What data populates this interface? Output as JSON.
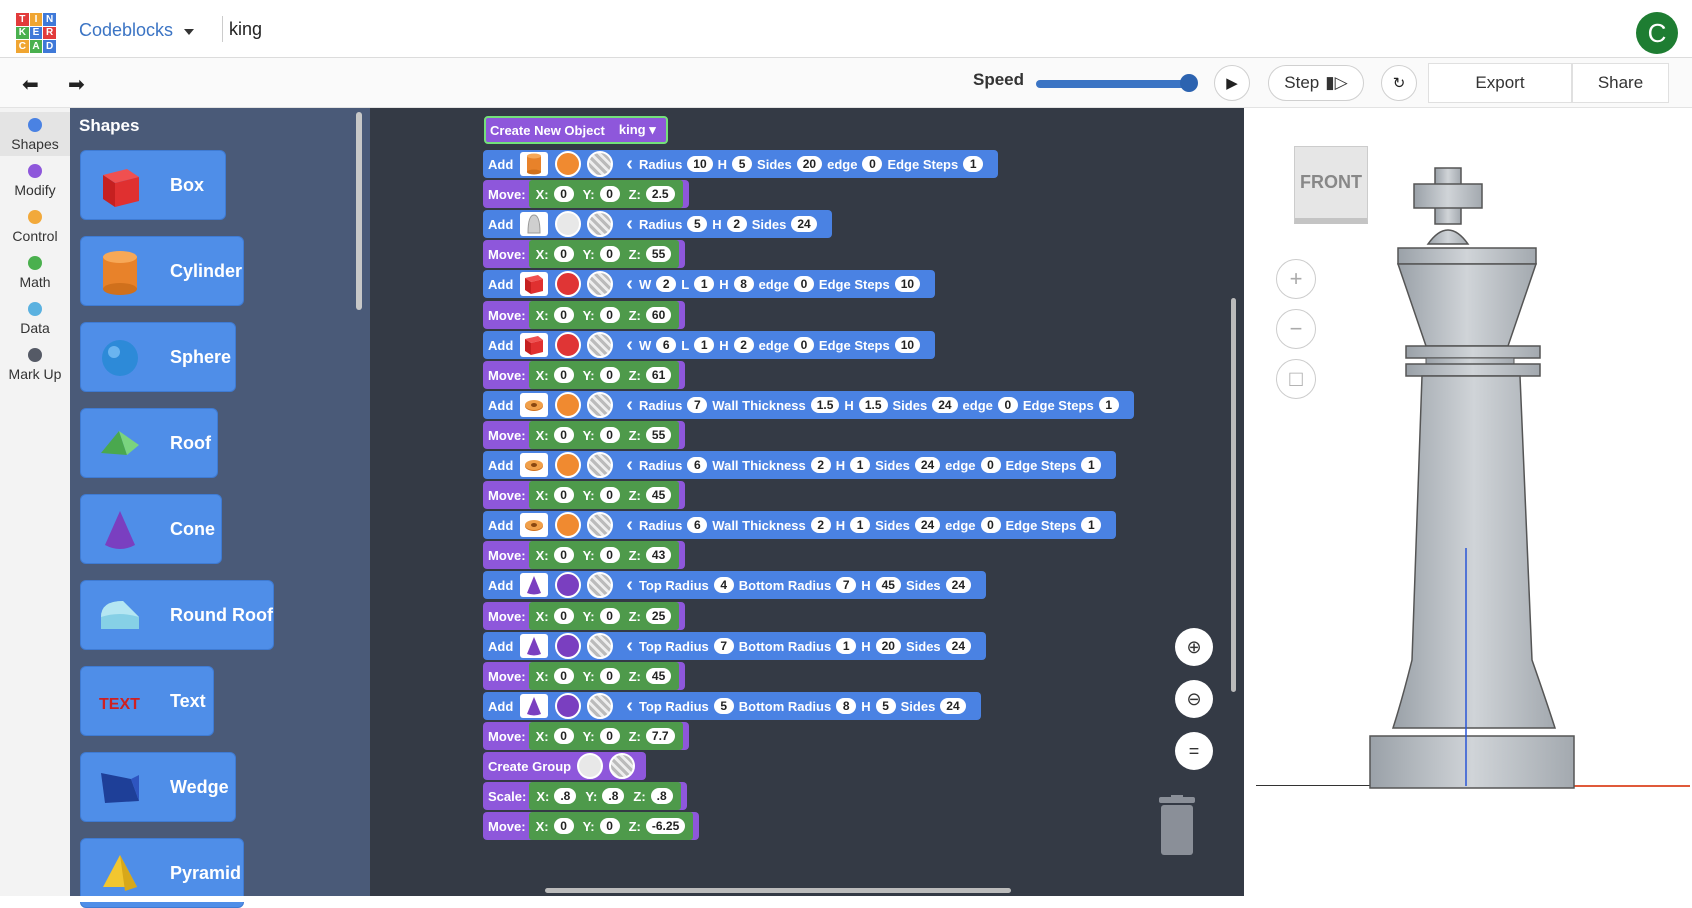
{
  "topbar": {
    "logo_letters": [
      "T",
      "I",
      "N",
      "K",
      "E",
      "R",
      "C",
      "A",
      "D"
    ],
    "app_name": "Codeblocks",
    "project_name": "king",
    "avatar_letter": "C"
  },
  "toolbar": {
    "speed_label": "Speed",
    "speed_value": 1.0,
    "step_label": "Step",
    "export_label": "Export",
    "share_label": "Share"
  },
  "categories": [
    {
      "label": "Shapes",
      "color": "#4a82e3",
      "active": true
    },
    {
      "label": "Modify",
      "color": "#8e57db"
    },
    {
      "label": "Control",
      "color": "#f2a93b"
    },
    {
      "label": "Math",
      "color": "#4ab04e"
    },
    {
      "label": "Data",
      "color": "#5ab1e0"
    },
    {
      "label": "Mark Up",
      "color": "#555a66"
    }
  ],
  "flyout": {
    "title": "Shapes",
    "shapes": [
      "Box",
      "Cylinder",
      "Sphere",
      "Roof",
      "Cone",
      "Round Roof",
      "Text",
      "Wedge",
      "Pyramid"
    ]
  },
  "program": {
    "create_label": "Create New Object",
    "object_name": "king",
    "add_label": "Add",
    "move_label": "Move:",
    "group_label": "Create Group",
    "scale_label": "Scale:",
    "rows": [
      {
        "kind": "add",
        "shape": "cylinder",
        "color": "#f08a30",
        "params": [
          [
            "Radius",
            "10"
          ],
          [
            "H",
            "5"
          ],
          [
            "Sides",
            "20"
          ],
          [
            "edge",
            "0"
          ],
          [
            "Edge Steps",
            "1"
          ]
        ]
      },
      {
        "kind": "move",
        "x": "0",
        "y": "0",
        "z": "2.5"
      },
      {
        "kind": "add",
        "shape": "paraboloid",
        "color": "#e8e8e8",
        "params": [
          [
            "Radius",
            "5"
          ],
          [
            "H",
            "2"
          ],
          [
            "Sides",
            "24"
          ]
        ]
      },
      {
        "kind": "move",
        "x": "0",
        "y": "0",
        "z": "55"
      },
      {
        "kind": "add",
        "shape": "box",
        "color": "#e03535",
        "params": [
          [
            "W",
            "2"
          ],
          [
            "L",
            "1"
          ],
          [
            "H",
            "8"
          ],
          [
            "edge",
            "0"
          ],
          [
            "Edge Steps",
            "10"
          ]
        ]
      },
      {
        "kind": "move",
        "x": "0",
        "y": "0",
        "z": "60"
      },
      {
        "kind": "add",
        "shape": "box",
        "color": "#e03535",
        "params": [
          [
            "W",
            "6"
          ],
          [
            "L",
            "1"
          ],
          [
            "H",
            "2"
          ],
          [
            "edge",
            "0"
          ],
          [
            "Edge Steps",
            "10"
          ]
        ]
      },
      {
        "kind": "move",
        "x": "0",
        "y": "0",
        "z": "61"
      },
      {
        "kind": "add",
        "shape": "tube",
        "color": "#f08a30",
        "params": [
          [
            "Radius",
            "7"
          ],
          [
            "Wall Thickness",
            "1.5"
          ],
          [
            "H",
            "1.5"
          ],
          [
            "Sides",
            "24"
          ],
          [
            "edge",
            "0"
          ],
          [
            "Edge Steps",
            "1"
          ]
        ]
      },
      {
        "kind": "move",
        "x": "0",
        "y": "0",
        "z": "55"
      },
      {
        "kind": "add",
        "shape": "tube",
        "color": "#f08a30",
        "params": [
          [
            "Radius",
            "6"
          ],
          [
            "Wall Thickness",
            "2"
          ],
          [
            "H",
            "1"
          ],
          [
            "Sides",
            "24"
          ],
          [
            "edge",
            "0"
          ],
          [
            "Edge Steps",
            "1"
          ]
        ]
      },
      {
        "kind": "move",
        "x": "0",
        "y": "0",
        "z": "45"
      },
      {
        "kind": "add",
        "shape": "tube",
        "color": "#f08a30",
        "params": [
          [
            "Radius",
            "6"
          ],
          [
            "Wall Thickness",
            "2"
          ],
          [
            "H",
            "1"
          ],
          [
            "Sides",
            "24"
          ],
          [
            "edge",
            "0"
          ],
          [
            "Edge Steps",
            "1"
          ]
        ]
      },
      {
        "kind": "move",
        "x": "0",
        "y": "0",
        "z": "43"
      },
      {
        "kind": "add",
        "shape": "cone",
        "color": "#7a3fc0",
        "params": [
          [
            "Top Radius",
            "4"
          ],
          [
            "Bottom Radius",
            "7"
          ],
          [
            "H",
            "45"
          ],
          [
            "Sides",
            "24"
          ]
        ]
      },
      {
        "kind": "move",
        "x": "0",
        "y": "0",
        "z": "25"
      },
      {
        "kind": "add",
        "shape": "cone",
        "color": "#7a3fc0",
        "params": [
          [
            "Top Radius",
            "7"
          ],
          [
            "Bottom Radius",
            "1"
          ],
          [
            "H",
            "20"
          ],
          [
            "Sides",
            "24"
          ]
        ]
      },
      {
        "kind": "move",
        "x": "0",
        "y": "0",
        "z": "45"
      },
      {
        "kind": "add",
        "shape": "cone",
        "color": "#7a3fc0",
        "params": [
          [
            "Top Radius",
            "5"
          ],
          [
            "Bottom Radius",
            "8"
          ],
          [
            "H",
            "5"
          ],
          [
            "Sides",
            "24"
          ]
        ]
      },
      {
        "kind": "move",
        "x": "0",
        "y": "0",
        "z": "7.7"
      },
      {
        "kind": "group"
      },
      {
        "kind": "scale",
        "x": ".8",
        "y": ".8",
        "z": ".8"
      },
      {
        "kind": "move",
        "x": "0",
        "y": "0",
        "z": "-6.25"
      }
    ]
  },
  "viewport": {
    "view_label": "FRONT"
  },
  "icons": [
    "undo-icon",
    "redo-icon",
    "play-icon",
    "step-icon",
    "reset-icon",
    "zoom-in-icon",
    "zoom-out-icon",
    "zoom-fit-icon",
    "trash-icon",
    "home-view-icon"
  ]
}
